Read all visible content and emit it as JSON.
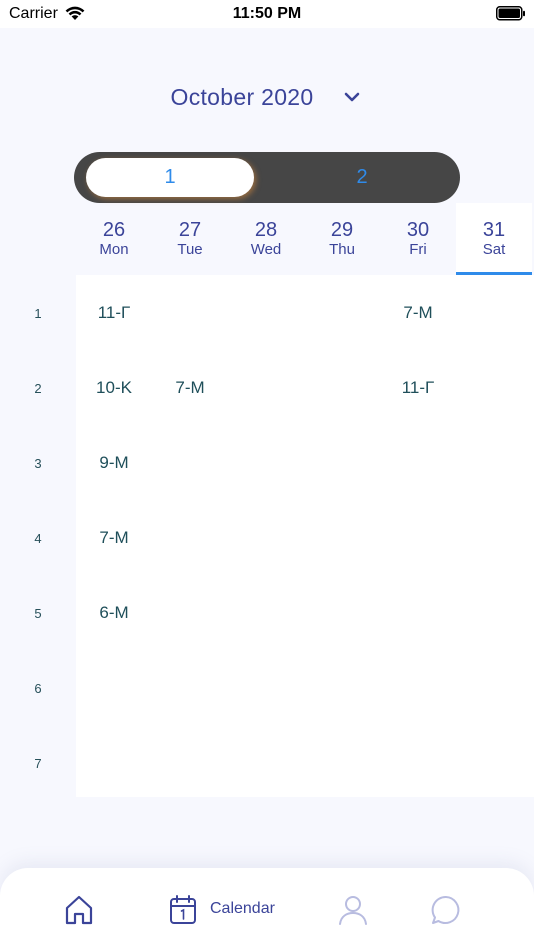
{
  "status_bar": {
    "carrier": "Carrier",
    "time": "11:50 PM"
  },
  "header": {
    "month": "October 2020"
  },
  "segment": {
    "options": [
      "1",
      "2"
    ],
    "selected_index": 0
  },
  "days": [
    {
      "num": "26",
      "name": "Mon"
    },
    {
      "num": "27",
      "name": "Tue"
    },
    {
      "num": "28",
      "name": "Wed"
    },
    {
      "num": "29",
      "name": "Thu"
    },
    {
      "num": "30",
      "name": "Fri"
    },
    {
      "num": "31",
      "name": "Sat"
    }
  ],
  "selected_day_index": 5,
  "periods": [
    "1",
    "2",
    "3",
    "4",
    "5",
    "6",
    "7"
  ],
  "schedule": [
    [
      "11-Г",
      "",
      "",
      "",
      "7-M",
      ""
    ],
    [
      "10-K",
      "7-M",
      "",
      "",
      "11-Г",
      ""
    ],
    [
      "9-M",
      "",
      "",
      "",
      "",
      ""
    ],
    [
      "7-M",
      "",
      "",
      "",
      "",
      ""
    ],
    [
      "6-M",
      "",
      "",
      "",
      "",
      ""
    ],
    [
      "",
      "",
      "",
      "",
      "",
      ""
    ],
    [
      "",
      "",
      "",
      "",
      "",
      ""
    ]
  ],
  "tab_bar": {
    "calendar_label": "Calendar",
    "active_tab": "calendar"
  },
  "colors": {
    "accent": "#3b4499",
    "blue": "#2f8bea",
    "text_dark": "#1f4f5a",
    "toggle_bg": "#464646"
  }
}
